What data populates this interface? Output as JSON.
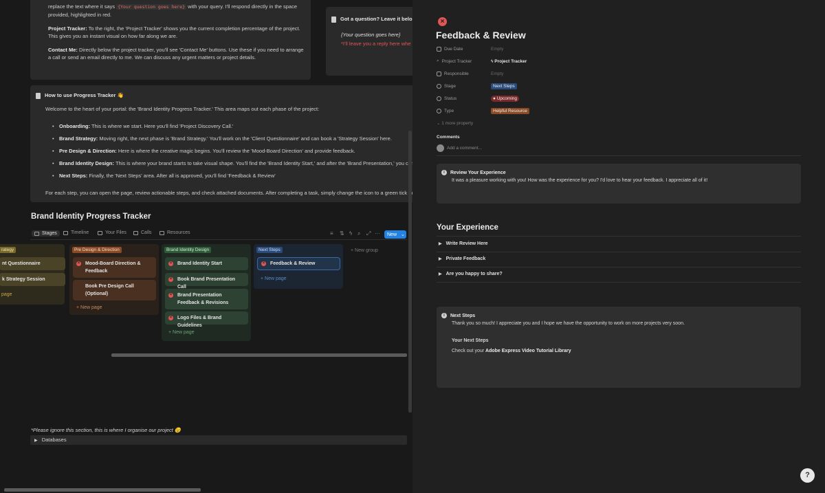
{
  "left": {
    "top_callout": {
      "line1_pre": "replace the text where it says ",
      "line1_code": "{Your question goes here}",
      "line1_post": " with your query. I'll respond directly in the space",
      "line2": "provided, highlighted in red.",
      "tracker_label": "Project Tracker:",
      "tracker_text": " To the right, the 'Project Tracker' shows you the current completion percentage of the project.",
      "tracker_text2": "This gives you an instant visual on how far along we are.",
      "contact_label": "Contact Me:",
      "contact_text": " Directly below the project tracker, you'll see 'Contact Me' buttons. Use these if you need to arrange",
      "contact_text2": "a call or send an email directly to me. We can discuss any urgent matters or project details."
    },
    "question_box": {
      "title": "Got a question? Leave it belo",
      "placeholder": "{Your question goes here}",
      "reply": "*I'll leave you a reply here whe"
    },
    "howto": {
      "title": "How to use Progress Tracker 👋",
      "intro": "Welcome to the heart of your portal: the 'Brand Identity Progress Tracker.' This area maps out each phase of the project:",
      "items": [
        {
          "label": "Onboarding:",
          "text": " This is where we start. Here you'll find  'Project Discovery Call.'"
        },
        {
          "label": "Brand Strategy:",
          "text": " Moving right, the next phase is 'Brand Strategy.' You'll work on the 'Client Questionnaire' and can book a 'Strategy Session' here."
        },
        {
          "label": "Pre Design & Direction:",
          "text": " Here is where the creative magic begins. You'll review the 'Mood-Board Direction' and provide feedback."
        },
        {
          "label": "Brand Identity Design:",
          "text": " This is where your brand starts to take visual shape. You'll find the 'Brand Identity Start,' and after the 'Brand Presentation,' you can"
        },
        {
          "label": "Next Steps:",
          "text": " Finally, the 'Next Steps' area. After all is approved, you'll find 'Feedback & Review'"
        }
      ],
      "outro": "For each step, you can open the page, review actionable steps, and check attached documents. After completing a task, simply change the icon to a green tick to"
    },
    "tracker": {
      "title": "Brand Identity Progress Tracker",
      "views": [
        "Stages",
        "Timeline",
        "Your Files",
        "Calls",
        "Resources"
      ],
      "new_label": "New",
      "new_group": "New group",
      "groups": [
        {
          "name": "rategy",
          "cards": [
            "nt Questionnaire",
            "k Strategy Session"
          ],
          "new_page": "page",
          "color": "#4a4328",
          "tag": "#7a6a2a"
        },
        {
          "name": "Pre Design & Direction",
          "cards": [
            "Mood-Board Direction & Feedback",
            "Book Pre Design Call (Optional)"
          ],
          "new_page": "New page",
          "color": "#3a2a20",
          "tag": "#8a4a25"
        },
        {
          "name": "Brand Identity Design",
          "cards": [
            "Brand Identity Start",
            "Book Brand Presentation Call",
            "Brand Presentation Feedback & Revisions",
            "Logo Files & Brand Guidelines"
          ],
          "new_page": "New page",
          "color": "#243228",
          "tag": "#2f5a3a"
        },
        {
          "name": "Next Steps",
          "cards": [
            "Feedback & Review"
          ],
          "new_page": "New page",
          "color": "#1f2a38",
          "tag": "#2a4a7a"
        }
      ]
    },
    "note": "*Please ignore this section, this is where I organise our project 😉",
    "databases": "Databases"
  },
  "right": {
    "title": "Feedback & Review",
    "properties": [
      {
        "key": "Due Date",
        "value": "Empty"
      },
      {
        "key": "Project Tracker",
        "value": "Project Tracker"
      },
      {
        "key": "Responsible",
        "value": "Empty"
      },
      {
        "key": "Stage",
        "value": "Next Steps"
      },
      {
        "key": "Status",
        "value": "Upcoming"
      },
      {
        "key": "Type",
        "value": "Helpful Resource"
      }
    ],
    "more_property": "1 more property",
    "comments_label": "Comments",
    "add_comment": "Add a comment...",
    "review_callout": {
      "title": "Review Your Experience",
      "text": "It was a pleasure working with you! How was the experience for you? I'd love to hear your feedback. I appreciate all of it!"
    },
    "your_experience": "Your Experience",
    "toggles": [
      "Write Review Here",
      "Private Feedback",
      "Are you happy to share?"
    ],
    "next_callout": {
      "title": "Next Steps",
      "text": "Thank you so much! I appreciate you and I hope we have the opportunity to work on more projects very soon.",
      "sub_title": "Your Next Steps",
      "sub_pre": "Check out your ",
      "sub_bold": "Adobe Express Video Tutorial Library"
    }
  }
}
